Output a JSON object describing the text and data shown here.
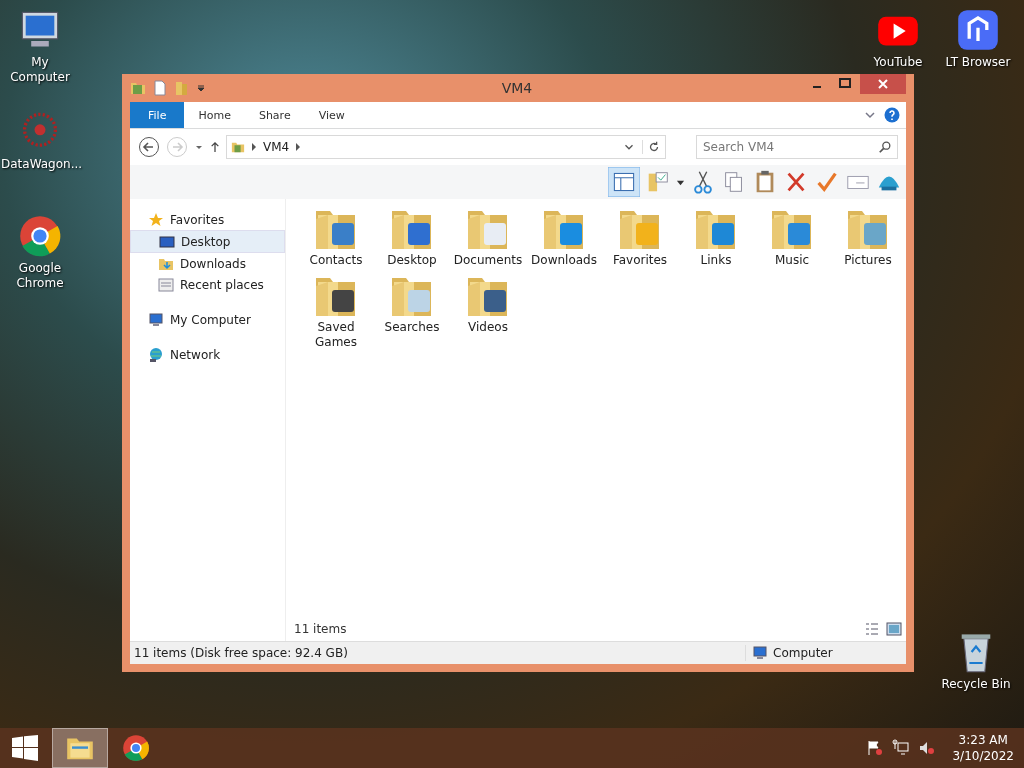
{
  "desktop_icons": [
    {
      "label": "My Computer",
      "kind": "computer"
    },
    {
      "label": "DataWagon...",
      "kind": "datawagon"
    },
    {
      "label": "Google Chrome",
      "kind": "chrome"
    },
    {
      "label": "YouTube",
      "kind": "youtube"
    },
    {
      "label": "LT Browser",
      "kind": "ltbrowser"
    },
    {
      "label": "Recycle Bin",
      "kind": "recyclebin"
    }
  ],
  "window": {
    "title": "VM4",
    "ribbon_tabs": [
      {
        "label": "File",
        "selected": true
      },
      {
        "label": "Home",
        "selected": false
      },
      {
        "label": "Share",
        "selected": false
      },
      {
        "label": "View",
        "selected": false
      }
    ],
    "address": {
      "path": "VM4"
    },
    "search": {
      "placeholder": "Search VM4"
    },
    "nav": [
      {
        "label": "Favorites",
        "kind": "favorites",
        "children": [
          {
            "label": "Desktop",
            "kind": "desktop",
            "selected": true
          },
          {
            "label": "Downloads",
            "kind": "downloads",
            "selected": false
          },
          {
            "label": "Recent places",
            "kind": "recent",
            "selected": false
          }
        ]
      },
      {
        "label": "My Computer",
        "kind": "computer"
      },
      {
        "label": "Network",
        "kind": "network"
      }
    ],
    "items": [
      {
        "label": "Contacts",
        "kind": "contacts"
      },
      {
        "label": "Desktop",
        "kind": "desktop"
      },
      {
        "label": "Documents",
        "kind": "documents"
      },
      {
        "label": "Downloads",
        "kind": "downloads"
      },
      {
        "label": "Favorites",
        "kind": "favorites"
      },
      {
        "label": "Links",
        "kind": "links"
      },
      {
        "label": "Music",
        "kind": "music"
      },
      {
        "label": "Pictures",
        "kind": "pictures"
      },
      {
        "label": "Saved Games",
        "kind": "games"
      },
      {
        "label": "Searches",
        "kind": "searches"
      },
      {
        "label": "Videos",
        "kind": "videos"
      }
    ],
    "item_count": "11 items",
    "status_text": "11 items (Disk free space: 92.4 GB)",
    "status_location": "Computer"
  },
  "taskbar": {
    "apps": [
      {
        "kind": "explorer",
        "selected": true
      },
      {
        "kind": "chrome",
        "selected": false
      }
    ],
    "time": "3:23 AM",
    "date": "3/10/2022"
  }
}
